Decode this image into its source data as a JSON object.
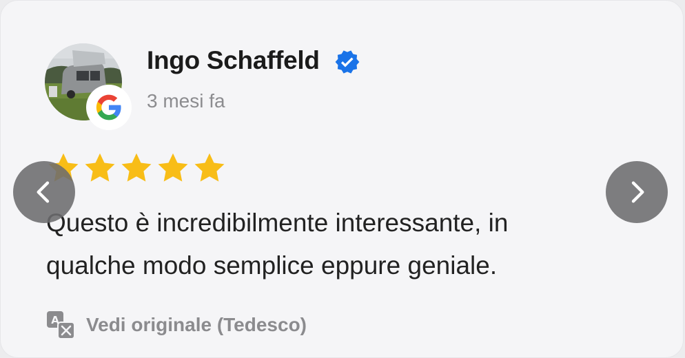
{
  "review": {
    "reviewer_name": "Ingo Schaffeld",
    "verified_icon": "verified-badge-icon",
    "source_icon": "google-g-icon",
    "timestamp": "3 mesi fa",
    "rating": 5,
    "rating_max": 5,
    "text": "Questo è incredibilmente interessante, in qualche modo semplice eppure geniale.",
    "translate_label": "Vedi originale (Tedesco)",
    "translate_icon": "translate-icon"
  },
  "navigation": {
    "prev_icon": "chevron-left-icon",
    "next_icon": "chevron-right-icon"
  },
  "colors": {
    "star": "#f8bd17",
    "verified": "#1a73e8",
    "nav_button": "#6c6c6e",
    "card_background": "#f5f5f7"
  }
}
